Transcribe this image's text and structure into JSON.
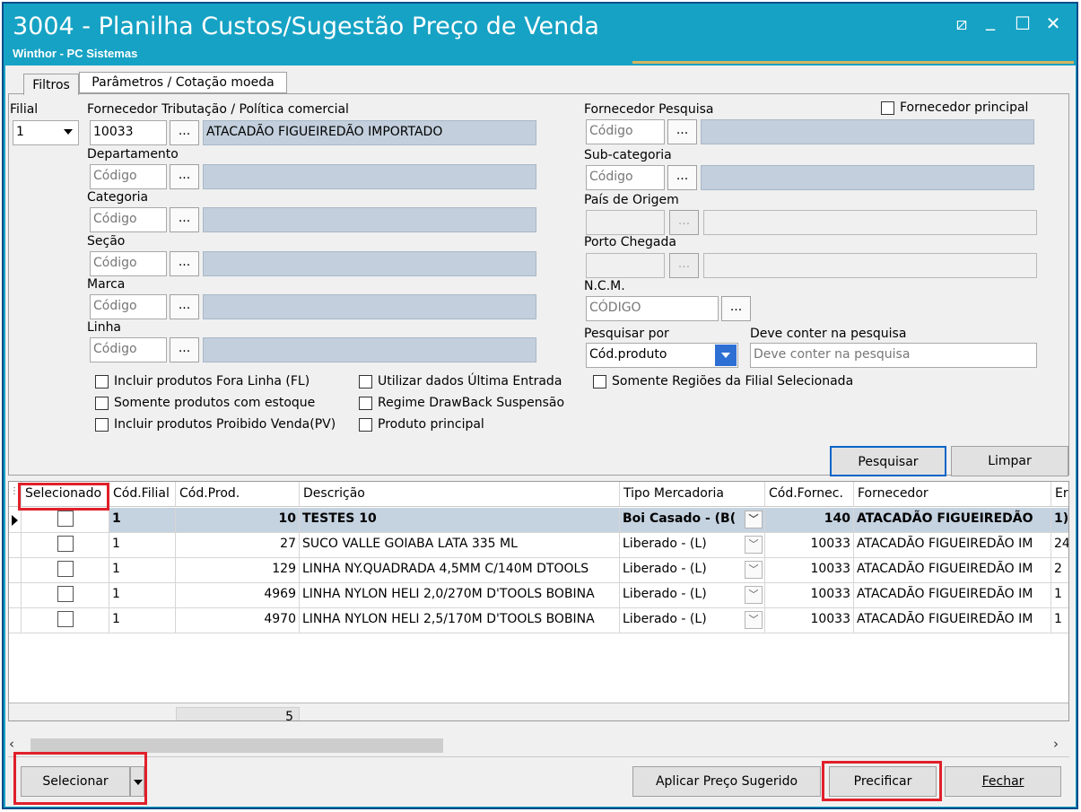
{
  "window": {
    "title": "3004 - Planilha Custos/Sugestão Preço de Venda",
    "subtitle": "Winthor - PC Sistemas",
    "controls": {
      "restore": "⧄",
      "minimize": "_",
      "maximize": "☐",
      "close": "✕"
    }
  },
  "tabs": [
    {
      "label": "Filtros"
    },
    {
      "label": "Parâmetros / Cotação moeda"
    }
  ],
  "filters": {
    "filial": {
      "label": "Filial",
      "value": "1"
    },
    "fornecedor_trib": {
      "label": "Fornecedor Tributação / Política comercial",
      "code": "10033",
      "name": "ATACADÃO FIGUEIREDÃO IMPORTADO"
    },
    "departamento": {
      "label": "Departamento",
      "placeholder": "Código"
    },
    "categoria": {
      "label": "Categoria",
      "placeholder": "Código"
    },
    "secao": {
      "label": "Seção",
      "placeholder": "Código"
    },
    "marca": {
      "label": "Marca",
      "placeholder": "Código"
    },
    "linha": {
      "label": "Linha",
      "placeholder": "Código"
    },
    "fornecedor_pesquisa": {
      "label": "Fornecedor Pesquisa",
      "placeholder": "Código"
    },
    "fornecedor_principal": {
      "label": "Fornecedor principal"
    },
    "subcategoria": {
      "label": "Sub-categoria",
      "placeholder": "Código"
    },
    "pais_origem": {
      "label": "País de Origem"
    },
    "porto_chegada": {
      "label": "Porto Chegada"
    },
    "ncm": {
      "label": "N.C.M.",
      "placeholder": "CÓDIGO"
    },
    "pesquisar_por": {
      "label": "Pesquisar por",
      "value": "Cód.produto"
    },
    "deve_conter": {
      "label": "Deve conter na pesquisa",
      "placeholder": "Deve conter na pesquisa"
    },
    "ellipsis": "...",
    "checkboxes": {
      "fora_linha": "Incluir produtos Fora Linha (FL)",
      "com_estoque": "Somente produtos com estoque",
      "proibido_venda": "Incluir produtos Proibido Venda(PV)",
      "ultima_entrada": "Utilizar dados Última Entrada",
      "drawback": "Regime DrawBack Suspensão",
      "produto_principal": "Produto principal",
      "regioes_filial": "Somente Regiões da Filial Selecionada"
    }
  },
  "actions": {
    "pesquisar": "Pesquisar",
    "limpar": "Limpar"
  },
  "grid": {
    "columns": [
      "Selecionado",
      "Cód.Filial",
      "Cód.Prod.",
      "Descrição",
      "Tipo Mercadoria",
      "Cód.Fornec.",
      "Fornecedor",
      "Er"
    ],
    "rows": [
      {
        "filial": "1",
        "prod": "10",
        "desc": "TESTES 10",
        "tipo": "Boi Casado - (B(",
        "codforn": "140",
        "forn": "ATACADÃO FIGUEIREDÃO",
        "extra": "1)"
      },
      {
        "filial": "1",
        "prod": "27",
        "desc": "SUCO VALLE GOIABA LATA 335 ML",
        "tipo": "Liberado - (L)",
        "codforn": "10033",
        "forn": "ATACADÃO FIGUEIREDÃO IM",
        "extra": "24"
      },
      {
        "filial": "1",
        "prod": "129",
        "desc": "LINHA NY.QUADRADA 4,5MM C/140M DTOOLS",
        "tipo": "Liberado - (L)",
        "codforn": "10033",
        "forn": "ATACADÃO FIGUEIREDÃO IM",
        "extra": "2"
      },
      {
        "filial": "1",
        "prod": "4969",
        "desc": "LINHA NYLON HELI 2,0/270M D'TOOLS BOBINA",
        "tipo": "Liberado - (L)",
        "codforn": "10033",
        "forn": "ATACADÃO FIGUEIREDÃO IM",
        "extra": "1"
      },
      {
        "filial": "1",
        "prod": "4970",
        "desc": "LINHA NYLON HELI 2,5/170M D'TOOLS BOBINA",
        "tipo": "Liberado - (L)",
        "codforn": "10033",
        "forn": "ATACADÃO FIGUEIREDÃO IM",
        "extra": "1"
      }
    ],
    "footer_count": "5"
  },
  "bottom": {
    "selecionar": "Selecionar",
    "aplicar": "Aplicar Preço Sugerido",
    "precificar": "Precificar",
    "fechar": "Fechar"
  },
  "colors": {
    "titlebar": "#16a2c4",
    "highlight": "#e0202a",
    "readonly_field": "#c3cfdc",
    "selected_row": "#c5d2e0"
  }
}
